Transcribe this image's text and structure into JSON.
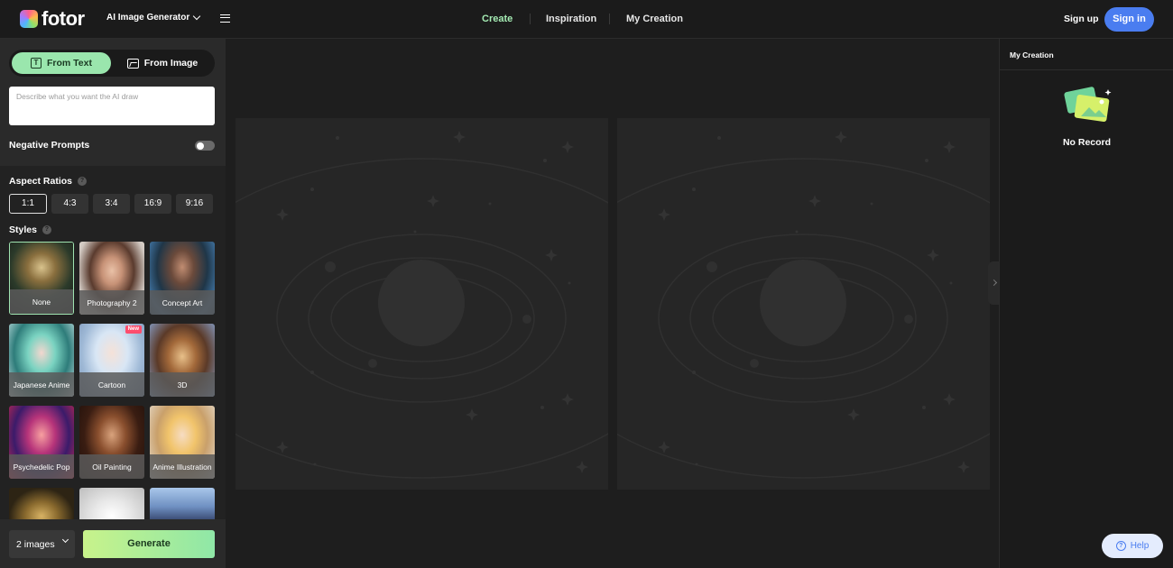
{
  "brand": {
    "logo_text": "fotor",
    "product": "AI Image Generator"
  },
  "nav": {
    "create": "Create",
    "inspiration": "Inspiration",
    "my_creation": "My Creation",
    "active": "Create",
    "active_color": "#a5ecb4"
  },
  "auth": {
    "sign_up": "Sign up",
    "sign_in": "Sign in",
    "sign_in_color": "#4a7df0"
  },
  "mode_tabs": {
    "from_text": "From Text",
    "from_image": "From Image",
    "active": "From Text",
    "active_color": "#9ae6ad"
  },
  "prompt": {
    "placeholder": "Describe what you want the AI draw",
    "value": ""
  },
  "negative_prompts": {
    "label": "Negative Prompts",
    "enabled": false
  },
  "aspect_ratios": {
    "label": "Aspect Ratios",
    "options": [
      "1:1",
      "4:3",
      "3:4",
      "16:9",
      "9:16"
    ],
    "selected": "1:1"
  },
  "styles": {
    "label": "Styles",
    "selected": "None",
    "items": [
      {
        "name": "None"
      },
      {
        "name": "Photography 2"
      },
      {
        "name": "Concept Art"
      },
      {
        "name": "Japanese Anime"
      },
      {
        "name": "Cartoon",
        "badge": "New"
      },
      {
        "name": "3D"
      },
      {
        "name": "Psychedelic Pop"
      },
      {
        "name": "Oil Painting"
      },
      {
        "name": "Anime Illustration"
      }
    ]
  },
  "generation": {
    "count_label": "2 images",
    "generate_label": "Generate"
  },
  "right_panel": {
    "title": "My Creation",
    "empty_text": "No Record"
  },
  "help": {
    "label": "Help"
  }
}
